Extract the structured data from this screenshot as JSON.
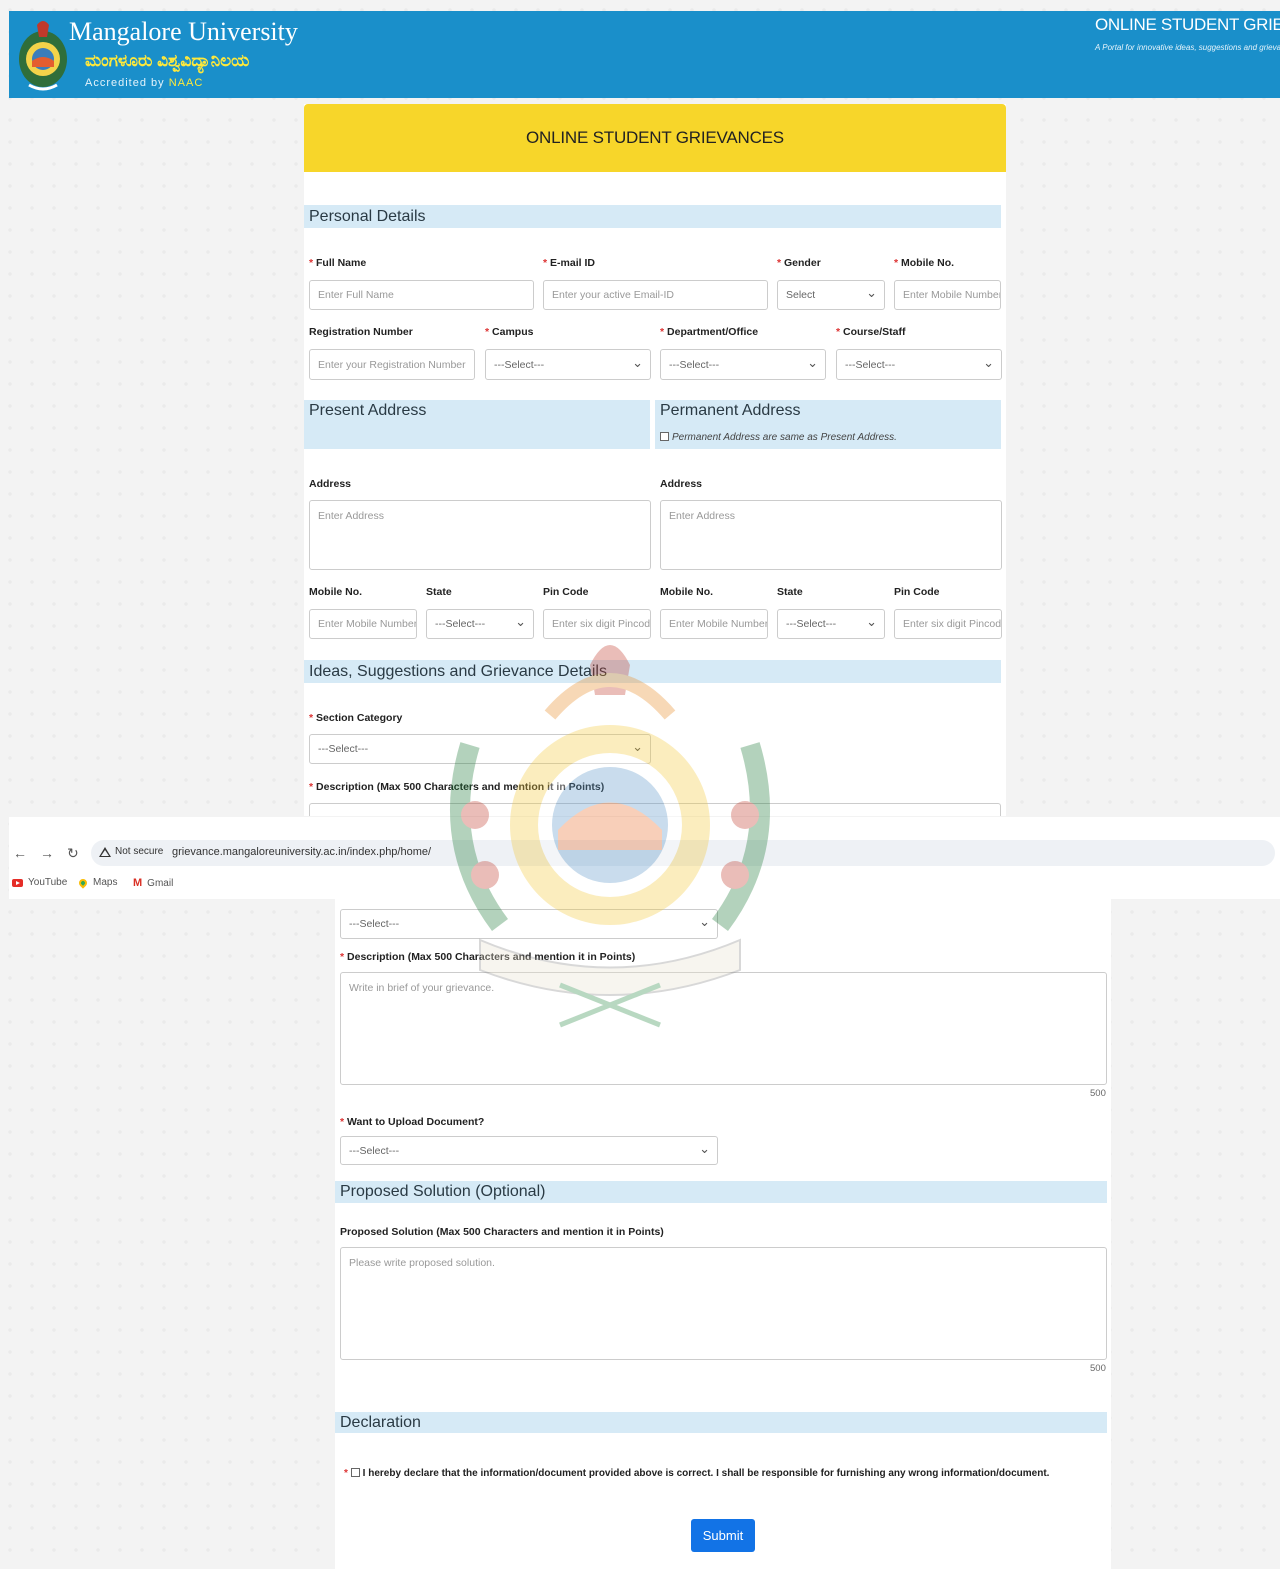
{
  "header": {
    "university_name": "Mangalore University",
    "university_name_kannada": "ಮಂಗಳೂರು ವಿಶ್ವವಿದ್ಯಾನಿಲಯ",
    "accredited_prefix": "Accredited by ",
    "accredited_body": "NAAC",
    "portal_title": "ONLINE STUDENT GRIEVANC",
    "portal_subtitle": "A Portal for innovative ideas, suggestions and grievances..."
  },
  "banner": {
    "title": "ONLINE STUDENT GRIEVANCES"
  },
  "personal": {
    "heading": "Personal Details",
    "full_name": {
      "label": "Full Name",
      "placeholder": "Enter Full Name"
    },
    "email": {
      "label": "E-mail ID",
      "placeholder": "Enter your active Email-ID"
    },
    "gender": {
      "label": "Gender",
      "value": "Select"
    },
    "mobile": {
      "label": "Mobile No.",
      "placeholder": "Enter Mobile Number"
    },
    "registration": {
      "label": "Registration Number",
      "placeholder": "Enter your Registration Number"
    },
    "campus": {
      "label": "Campus",
      "value": "---Select---"
    },
    "department": {
      "label": "Department/Office",
      "value": "---Select---"
    },
    "course": {
      "label": "Course/Staff",
      "value": "---Select---"
    }
  },
  "present": {
    "heading": "Present Address",
    "address": {
      "label": "Address",
      "placeholder": "Enter Address"
    },
    "mobile": {
      "label": "Mobile No.",
      "placeholder": "Enter Mobile Number"
    },
    "state": {
      "label": "State",
      "value": "---Select---"
    },
    "pincode": {
      "label": "Pin Code",
      "placeholder": "Enter six digit Pincode"
    }
  },
  "permanent": {
    "heading": "Permanent Address",
    "same_note": "Permanent Address are same as Present Address.",
    "address": {
      "label": "Address",
      "placeholder": "Enter Address"
    },
    "mobile": {
      "label": "Mobile No.",
      "placeholder": "Enter Mobile Number"
    },
    "state": {
      "label": "State",
      "value": "---Select---"
    },
    "pincode": {
      "label": "Pin Code",
      "placeholder": "Enter six digit Pincode"
    }
  },
  "grievance": {
    "heading": "Ideas, Suggestions and Grievance Details",
    "section_category": {
      "label": "Section Category",
      "value": "---Select---"
    },
    "description": {
      "label": "Description (Max 500 Characters and mention it in Points)",
      "placeholder": "Write in brief of your grievance.",
      "count": "500"
    },
    "upload": {
      "label": "Want to Upload Document?",
      "value": "---Select---"
    }
  },
  "browser": {
    "not_secure": "Not secure",
    "url": "grievance.mangaloreuniversity.ac.in/index.php/home/",
    "bookmarks": [
      "YouTube",
      "Maps",
      "Gmail"
    ]
  },
  "solution": {
    "heading": "Proposed Solution (Optional)",
    "label": "Proposed Solution (Max 500 Characters and mention it in Points)",
    "placeholder": "Please write proposed solution.",
    "count": "500"
  },
  "declaration": {
    "heading": "Declaration",
    "text": "I hereby declare that the information/document provided above is correct. I shall be responsible for furnishing any wrong information/document."
  },
  "submit_label": "Submit",
  "colors": {
    "header_blue": "#1a8fca",
    "banner_yellow": "#f7d62a",
    "section_blue": "#d6eaf6",
    "submit_blue": "#1273e6",
    "required_red": "#d33"
  }
}
